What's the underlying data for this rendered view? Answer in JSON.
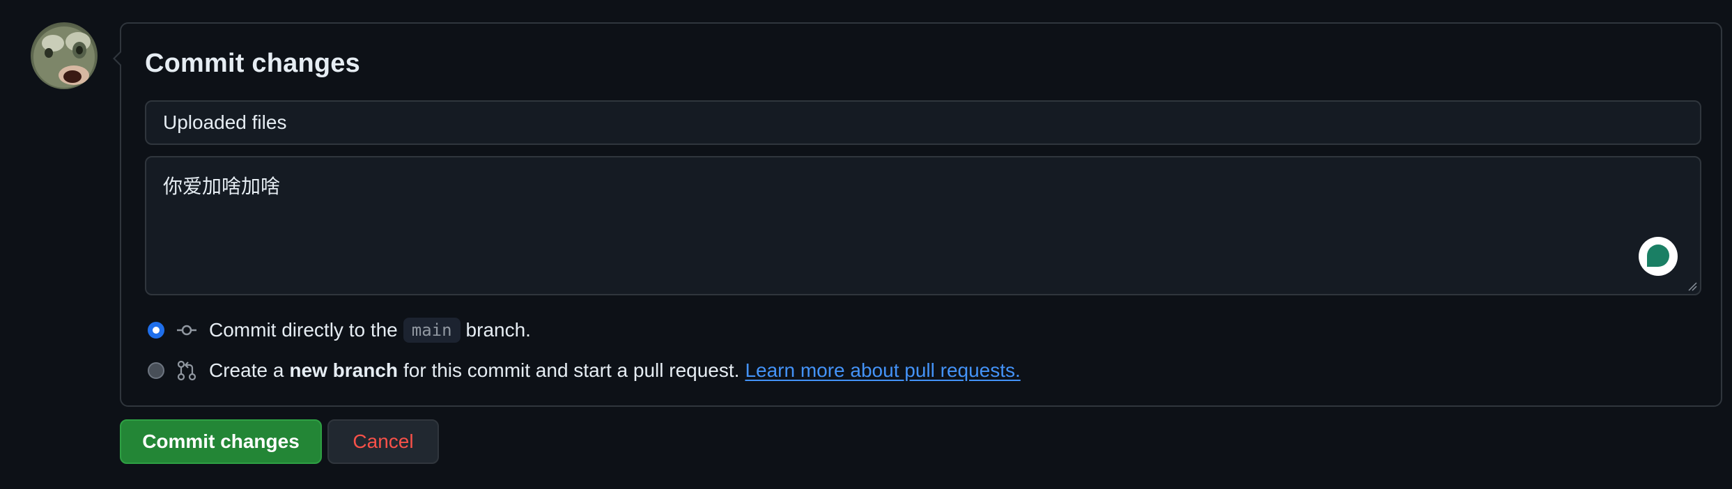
{
  "avatar": {
    "icon": "user-avatar"
  },
  "panel": {
    "title": "Commit changes",
    "summary": {
      "value": "Uploaded files"
    },
    "description": {
      "value": "你爱加啥加啥"
    },
    "options": [
      {
        "checked": true,
        "icon": "git-commit-icon",
        "prefix": "Commit directly to the",
        "branch": "main",
        "suffix": "branch."
      },
      {
        "checked": false,
        "icon": "git-pull-request-icon",
        "prefix": "Create a",
        "bold": "new branch",
        "middle": "for this commit and start a pull request.",
        "link": "Learn more about pull requests."
      }
    ]
  },
  "buttons": {
    "commit": "Commit changes",
    "cancel": "Cancel"
  },
  "colors": {
    "background": "#0d1117",
    "primary_button": "#238636",
    "cancel_text": "#f85149",
    "link": "#4493f8",
    "radio_checked": "#1f6feb"
  }
}
